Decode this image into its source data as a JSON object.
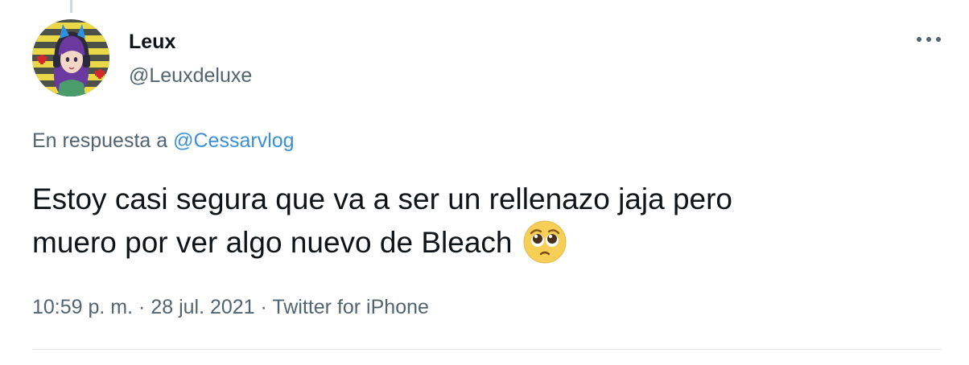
{
  "tweet": {
    "author": {
      "display_name": "Leux",
      "handle": "@Leuxdeluxe"
    },
    "reply": {
      "prefix": "En respuesta a",
      "mention": "@Cessarvlog"
    },
    "text_line1": "Estoy casi segura que va a ser un rellenazo jaja pero",
    "text_line2": "muero por ver algo nuevo de Bleach",
    "emoji": "pleading-face-emoji",
    "time": "10:59 p. m.",
    "date": "28 jul. 2021",
    "source": "Twitter for iPhone",
    "separator": "·"
  },
  "icons": {
    "more": "more-horizontal-icon"
  },
  "colors": {
    "link": "#3b8fd6",
    "secondary_text": "#536471",
    "primary_text": "#0f1419"
  }
}
